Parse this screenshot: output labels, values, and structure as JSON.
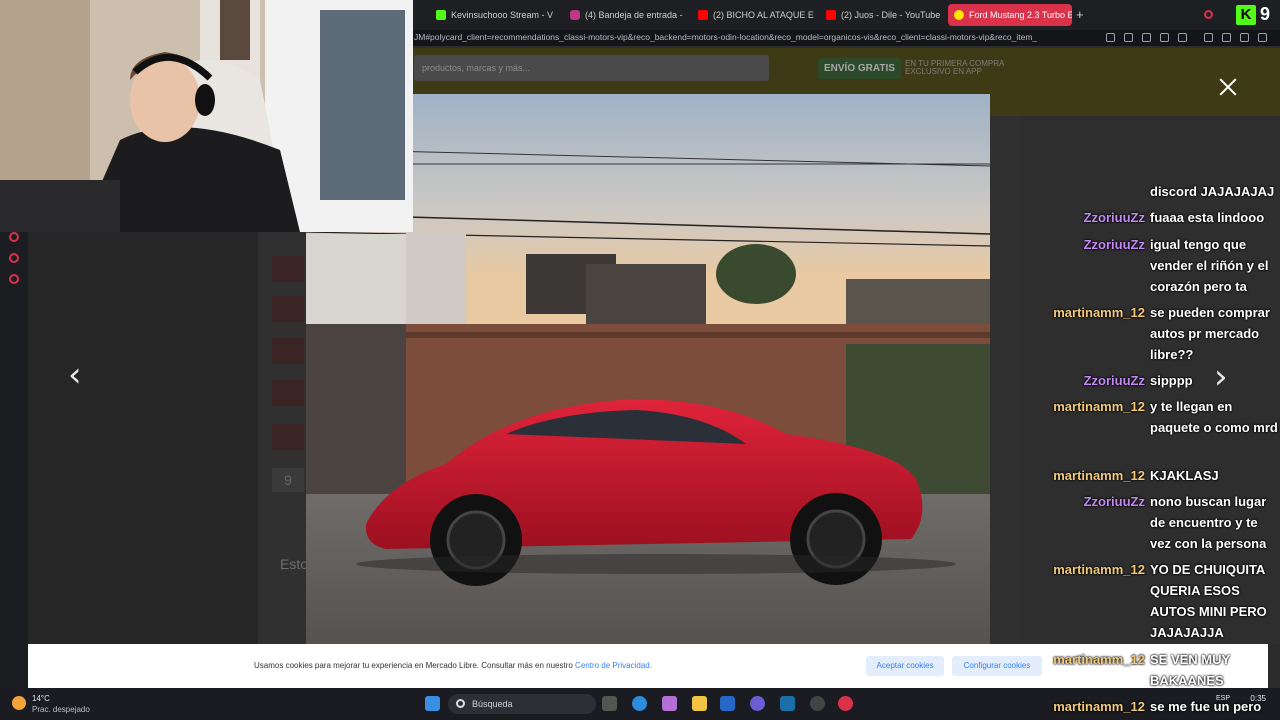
{
  "browser": {
    "tabs": [
      {
        "label": "Kevinsuchooo Stream - V",
        "icon": "kick-icon",
        "color": "#53fc18"
      },
      {
        "label": "(4) Bandeja de entrada -",
        "icon": "instagram-icon",
        "color": "#c13584"
      },
      {
        "label": "(2) BICHO AL ATAQUE EN",
        "icon": "youtube-icon",
        "color": "#ff0000"
      },
      {
        "label": "(2) Juos - Dile - YouTube",
        "icon": "youtube-icon",
        "color": "#ff0000"
      },
      {
        "label": "Ford Mustang 2.3 Turbo E",
        "icon": "mercadolibre-icon",
        "color": "#ffe600"
      }
    ],
    "url": "JM#polycard_client=recommendations_classi-motors-vip&reco_backend=motors-odin-location&reco_model=organicos-vis&reco_client=classi-motors-vip&reco_item_",
    "kick_number": "9"
  },
  "site": {
    "search_placeholder": "productos, marcas y más...",
    "envio_badge": "ENVÍO GRATIS",
    "envio_line1": "EN TU PRIMERA COMPRA",
    "envio_line2": "EXCLUSIVO EN APP",
    "thumb_more": "9",
    "section_start": "Esto"
  },
  "gallery": {
    "prev_icon": "chevron-left-icon",
    "next_icon": "chevron-right-icon",
    "close_icon": "close-icon"
  },
  "chat": [
    {
      "user": "",
      "text": "discord JAJAJAJAJ",
      "color": "#c389f5"
    },
    {
      "user": "ZzoriuuZz",
      "text": "fuaaa esta lindooo",
      "color": "#c389f5"
    },
    {
      "user": "ZzoriuuZz",
      "text": "igual tengo que vender el riñón y el corazón pero ta",
      "color": "#c389f5"
    },
    {
      "user": "martinamm_12",
      "text": "se pueden comprar autos pr mercado libre??",
      "color": "#f2c97a"
    },
    {
      "user": "ZzoriuuZz",
      "text": "sipppp",
      "color": "#c389f5"
    },
    {
      "user": "martinamm_12",
      "text": "y te llegan en paquete o como mrd",
      "color": "#f2c97a"
    },
    {
      "user": "martinamm_12",
      "text": "KJAKLASJ",
      "color": "#f2c97a"
    },
    {
      "user": "ZzoriuuZz",
      "text": "nono buscan lugar de encuentro y te vez con la persona",
      "color": "#c389f5"
    },
    {
      "user": "martinamm_12",
      "text": "YO DE CHUIQUITA QUERIA ESOS AUTOS MINI PERO JAJAJAJJA",
      "color": "#f2c97a"
    },
    {
      "user": "martinamm_12",
      "text": "SE VEN MUY BAKAANES",
      "color": "#f2c97a"
    },
    {
      "user": "martinamm_12",
      "text": "se me fue un pero",
      "color": "#f2c97a"
    }
  ],
  "cookie": {
    "text": "Usamos cookies para mejorar tu experiencia en Mercado Libre. Consultar más en nuestro ",
    "link": "Centro de Privacidad.",
    "accept": "Aceptar cookies",
    "configure": "Configurar cookies"
  },
  "taskbar": {
    "temp": "14°C",
    "weather": "Prac. despejado",
    "search": "Búsqueda",
    "lang": "ESP",
    "time": "0:35"
  }
}
